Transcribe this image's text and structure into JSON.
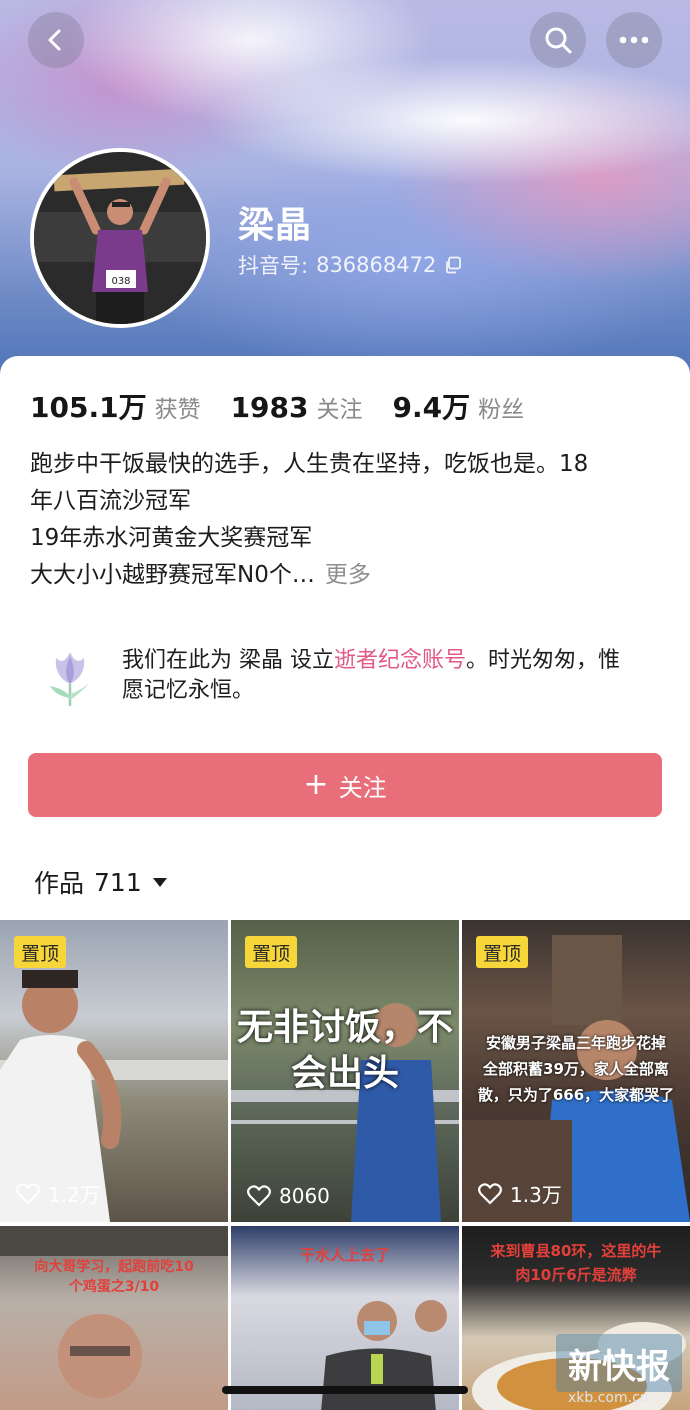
{
  "header": {
    "back_icon": "chevron-left-icon",
    "search_icon": "search-icon",
    "more_icon": "ellipsis-icon"
  },
  "profile": {
    "nickname": "梁晶",
    "douyin_id_label": "抖音号:",
    "douyin_id": "836868472",
    "copy_icon": "copy-icon",
    "avatar_bib": "038"
  },
  "stats": [
    {
      "value": "105.1万",
      "label": "获赞"
    },
    {
      "value": "1983",
      "label": "关注"
    },
    {
      "value": "9.4万",
      "label": "粉丝"
    }
  ],
  "bio": {
    "line1": "跑步中干饭最快的选手，人生贵在坚持，吃饭也是。18",
    "line2": "年八百流沙冠军",
    "line3": "19年赤水河黄金大奖赛冠军",
    "line4": "大大小小越野赛冠军N0个…",
    "more": "更多"
  },
  "memorial": {
    "text_before": "我们在此为 梁晶 设立",
    "link": "逝者纪念账号",
    "text_after": "。时光匆匆，惟愿记忆永恒。"
  },
  "follow_button": {
    "icon": "+",
    "label": "关注"
  },
  "works_tab": {
    "label": "作品",
    "count": "711",
    "dropdown_icon": "caret-down-icon"
  },
  "videos": [
    {
      "pinned": "置顶",
      "likes": "1.2万",
      "caption": ""
    },
    {
      "pinned": "置顶",
      "likes": "8060",
      "caption_line1": "无非讨饭，不",
      "caption_line2": "会出头"
    },
    {
      "pinned": "置顶",
      "likes": "1.3万",
      "caption_line1": "安徽男子梁晶三年跑步花掉",
      "caption_line2": "全部积蓄39万，家人全部离",
      "caption_line3": "散，只为了666，大家都哭了"
    },
    {
      "caption_line1": "向大哥学习，起跑前吃10",
      "caption_line2": "个鸡蛋之3/10"
    },
    {
      "caption_line1": "干水人上去了"
    },
    {
      "caption_line1": "来到曹县80环，这里的牛",
      "caption_line2": "肉10斤6斤是流弊"
    }
  ],
  "watermark": {
    "title": "新快报",
    "sub": "xkb.com.cn"
  },
  "colors": {
    "follow_button": "#e86f79",
    "memorial_link": "#e25a83",
    "pin_badge": "#f7d63a"
  }
}
